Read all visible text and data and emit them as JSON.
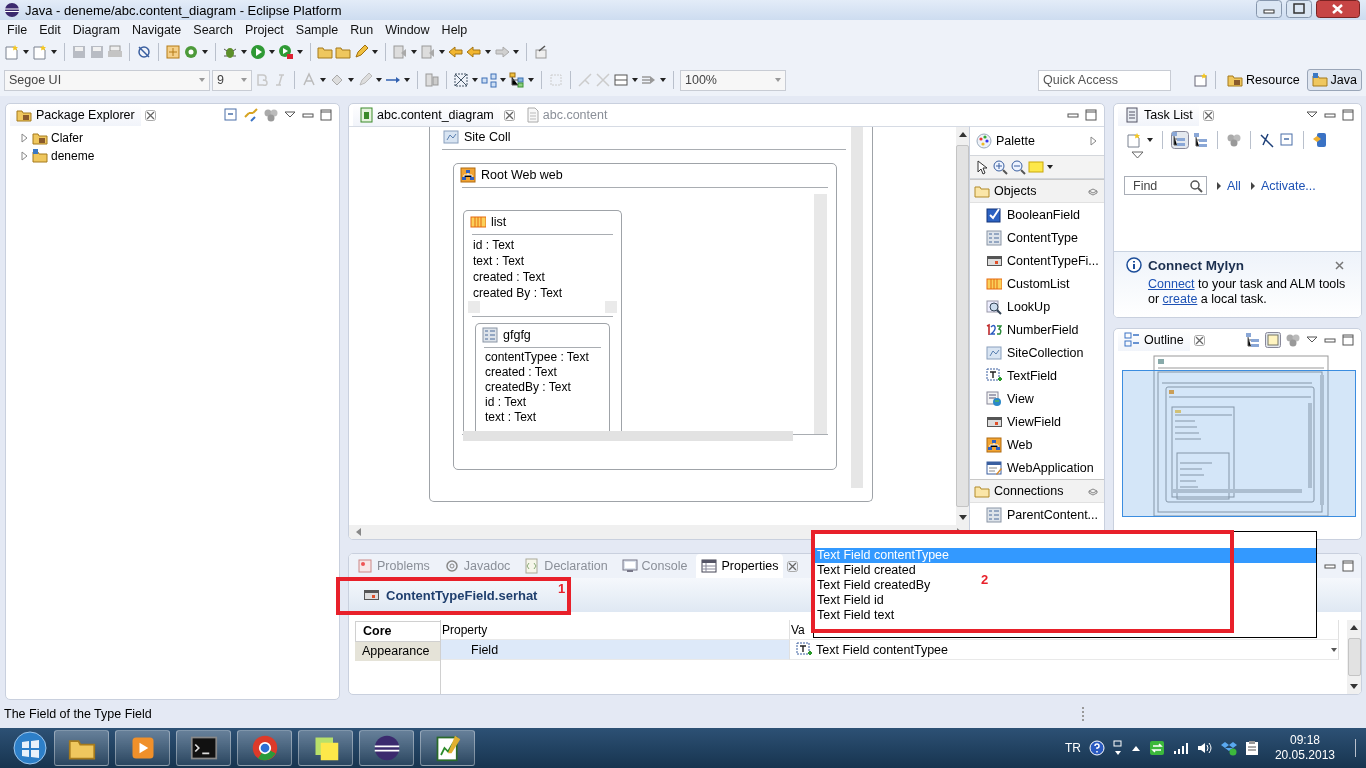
{
  "window": {
    "title": "Java - deneme/abc.content_diagram - Eclipse Platform"
  },
  "menu": [
    "File",
    "Edit",
    "Diagram",
    "Navigate",
    "Search",
    "Project",
    "Sample",
    "Run",
    "Window",
    "Help"
  ],
  "format_toolbar": {
    "font": "Segoe UI",
    "size": "9",
    "zoom": "100%"
  },
  "quick_access": {
    "placeholder": "Quick Access"
  },
  "perspectives": [
    {
      "label": "Resource",
      "selected": false
    },
    {
      "label": "Java",
      "selected": true
    }
  ],
  "package_explorer": {
    "title": "Package Explorer",
    "items": [
      {
        "label": "Clafer",
        "expanded": false
      },
      {
        "label": "deneme",
        "expanded": false
      }
    ]
  },
  "editor": {
    "tabs": [
      {
        "label": "abc.content_diagram",
        "selected": true
      },
      {
        "label": "abc.content",
        "selected": false
      }
    ],
    "diagram": {
      "site_collection": "Site Coll",
      "web": "Root Web web",
      "list": {
        "title": "list",
        "fields": [
          "id : Text",
          "text : Text",
          "created : Text",
          "created By : Text"
        ]
      },
      "content_type": {
        "title": "gfgfg",
        "fields": [
          "contentTypee : Text",
          "created : Text",
          "createdBy : Text",
          "id : Text",
          "text : Text"
        ]
      }
    }
  },
  "palette": {
    "title": "Palette",
    "groups": [
      {
        "label": "Objects",
        "items": [
          "BooleanField",
          "ContentType",
          "ContentTypeFi...",
          "CustomList",
          "LookUp",
          "NumberField",
          "SiteCollection",
          "TextField",
          "View",
          "ViewField",
          "Web",
          "WebApplication"
        ]
      },
      {
        "label": "Connections",
        "items": [
          "ParentContent..."
        ]
      }
    ]
  },
  "task_list": {
    "title": "Task List",
    "find": {
      "placeholder": "Find"
    },
    "links": [
      "All",
      "Activate..."
    ],
    "mylyn": {
      "title": "Connect Mylyn",
      "message": [
        {
          "kind": "link",
          "text": "Connect"
        },
        {
          "kind": "text",
          "text": "to your task and ALM tools"
        },
        {
          "kind": "break"
        },
        {
          "kind": "text",
          "text": "or"
        },
        {
          "kind": "link",
          "text": "create"
        },
        {
          "kind": "text",
          "text": "a local task."
        }
      ]
    }
  },
  "outline": {
    "title": "Outline"
  },
  "properties": {
    "tabs": [
      {
        "label": "Problems",
        "selected": false
      },
      {
        "label": "Javadoc",
        "selected": false
      },
      {
        "label": "Declaration",
        "selected": false
      },
      {
        "label": "Console",
        "selected": false
      },
      {
        "label": "Properties",
        "selected": true
      }
    ],
    "title": "ContentTypeField.serhat",
    "sections": [
      {
        "label": "Core",
        "selected": true
      },
      {
        "label": "Appearance",
        "selected": false
      }
    ],
    "columns": [
      "Property",
      "Va"
    ],
    "rows": [
      {
        "property": "Field",
        "value": "Text Field contentTypee",
        "selected": true
      }
    ],
    "dropdown": {
      "options": [
        {
          "label": "Text Field contentTypee",
          "selected": true
        },
        {
          "label": "Text Field created",
          "selected": false
        },
        {
          "label": "Text Field createdBy",
          "selected": false
        },
        {
          "label": "Text Field id",
          "selected": false
        },
        {
          "label": "Text Field text",
          "selected": false
        }
      ]
    }
  },
  "annotations": [
    {
      "label": "1"
    },
    {
      "label": "2"
    }
  ],
  "status_bar": {
    "text": "The Field of the Type Field"
  },
  "taskbar": {
    "language": "TR",
    "time": "09:18",
    "date": "20.05.2013"
  }
}
